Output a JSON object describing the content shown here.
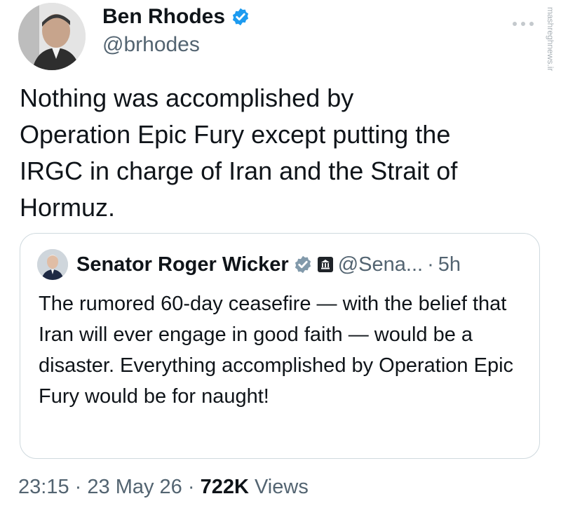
{
  "author": {
    "display_name": "Ben Rhodes",
    "handle": "@brhodes",
    "verified": true,
    "avatar_icon": "person-portrait-icon"
  },
  "tweet": {
    "text": "Nothing was accomplished by\nOperation Epic Fury except putting the\nIRGC in charge of Iran and the Strait of\nHormuz."
  },
  "quote": {
    "display_name": "Senator Roger Wicker",
    "verified": true,
    "badge_icon": "government-building-icon",
    "handle": "@Sena...",
    "separator": "·",
    "time": "5h",
    "text": "The rumored 60-day ceasefire — with the belief that Iran will ever engage in good faith — would be a disaster. Everything accomplished by Operation Epic Fury would be for naught!"
  },
  "meta": {
    "time": "23:15",
    "sep1": "·",
    "date": "23 May 26",
    "sep2": "·",
    "views_count": "722K",
    "views_label": "Views"
  },
  "watermark": {
    "text": "mashreghnews.ir"
  },
  "colors": {
    "text_primary": "#0f1419",
    "text_secondary": "#536471",
    "verified_blue": "#1d9bf0",
    "border": "#cfd9de"
  }
}
